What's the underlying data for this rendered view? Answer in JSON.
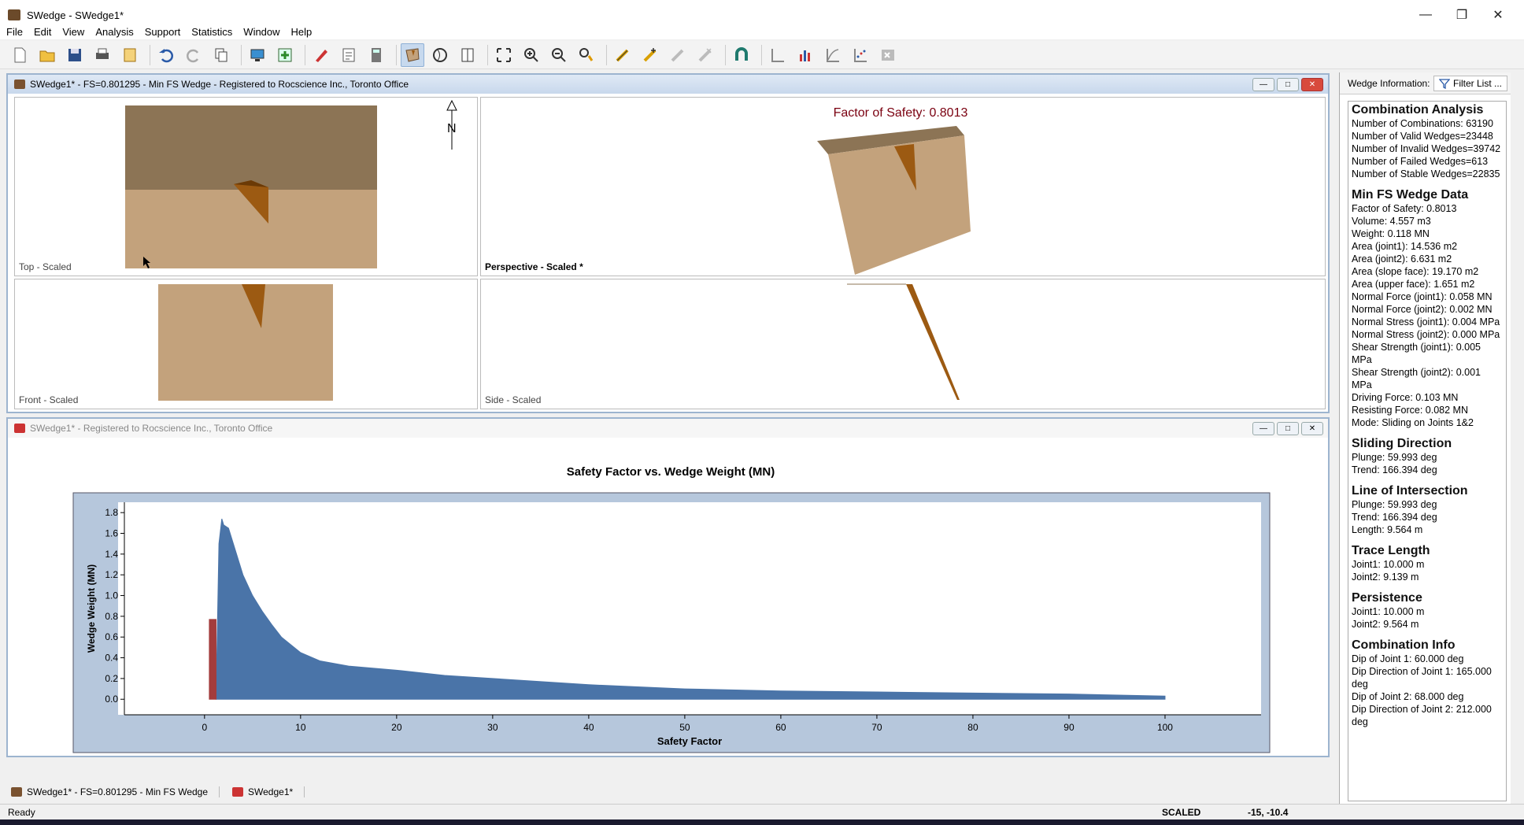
{
  "window": {
    "title": "SWedge - SWedge1*"
  },
  "menu": [
    "File",
    "Edit",
    "View",
    "Analysis",
    "Support",
    "Statistics",
    "Window",
    "Help"
  ],
  "view_window": {
    "title": "SWedge1* - FS=0.801295 - Min FS Wedge - Registered to Rocscience Inc., Toronto Office",
    "top_label": "Top - Scaled",
    "persp_label": "Perspective - Scaled *",
    "front_label": "Front - Scaled",
    "side_label": "Side - Scaled",
    "fs_title": "Factor of Safety: 0.8013",
    "north_label": "N"
  },
  "chart_window": {
    "title": "SWedge1* - Registered to Rocscience Inc., Toronto Office"
  },
  "chart_data": {
    "type": "area",
    "title": "Safety Factor vs. Wedge Weight (MN)",
    "xlabel": "Safety Factor",
    "ylabel": "Wedge Weight (MN)",
    "xlim": [
      -9,
      110
    ],
    "ylim": [
      -0.15,
      1.9
    ],
    "xticks": [
      0,
      10,
      20,
      30,
      40,
      50,
      60,
      70,
      80,
      90,
      100
    ],
    "yticks": [
      0.0,
      0.2,
      0.4,
      0.6,
      0.8,
      1.0,
      1.2,
      1.4,
      1.6,
      1.8
    ],
    "series": [
      {
        "color": "#4a74a8",
        "x": [
          1.2,
          1.5,
          1.8,
          2.0,
          2.5,
          3.0,
          3.5,
          4.0,
          5.0,
          6.0,
          7.0,
          8.0,
          10,
          12,
          15,
          20,
          25,
          30,
          40,
          50,
          60,
          70,
          80,
          90,
          100
        ],
        "y": [
          0.0,
          1.5,
          1.74,
          1.68,
          1.65,
          1.5,
          1.35,
          1.2,
          1.0,
          0.85,
          0.72,
          0.6,
          0.45,
          0.37,
          0.32,
          0.28,
          0.23,
          0.2,
          0.14,
          0.1,
          0.08,
          0.07,
          0.06,
          0.05,
          0.03
        ]
      },
      {
        "color": "#a33c3c",
        "x": [
          0.5,
          0.5,
          1.2,
          1.2
        ],
        "y": [
          0.0,
          0.77,
          0.77,
          0.0
        ]
      }
    ]
  },
  "info_panel": {
    "header_label": "Wedge Information:",
    "filter_label": "Filter List ...",
    "sections": [
      {
        "title": "Combination Analysis",
        "lines": [
          "Number of Combinations: 63190",
          "Number of Valid Wedges=23448",
          "Number of Invalid Wedges=39742",
          "Number of Failed Wedges=613",
          "Number of Stable Wedges=22835"
        ]
      },
      {
        "title": "Min FS Wedge Data",
        "lines": [
          "Factor of Safety: 0.8013",
          "Volume: 4.557 m3",
          "Weight: 0.118 MN",
          "Area (joint1): 14.536 m2",
          "Area (joint2): 6.631 m2",
          "Area (slope face): 19.170 m2",
          "Area (upper face): 1.651 m2",
          "Normal Force (joint1): 0.058 MN",
          "Normal Force (joint2): 0.002 MN",
          "Normal Stress (joint1): 0.004 MPa",
          "Normal Stress (joint2): 0.000 MPa",
          "Shear Strength (joint1): 0.005 MPa",
          "Shear Strength (joint2): 0.001 MPa",
          "Driving Force: 0.103 MN",
          "Resisting Force: 0.082 MN",
          "Mode: Sliding on Joints 1&2"
        ]
      },
      {
        "title": "Sliding Direction",
        "lines": [
          "Plunge: 59.993 deg",
          "Trend: 166.394 deg"
        ]
      },
      {
        "title": "Line of Intersection",
        "lines": [
          "Plunge: 59.993 deg",
          "Trend: 166.394 deg",
          "Length: 9.564 m"
        ]
      },
      {
        "title": "Trace Length",
        "lines": [
          "Joint1: 10.000 m",
          "Joint2: 9.139 m"
        ]
      },
      {
        "title": "Persistence",
        "lines": [
          "Joint1: 10.000 m",
          "Joint2: 9.564 m"
        ]
      },
      {
        "title": "Combination Info",
        "lines": [
          "Dip of Joint 1: 60.000 deg",
          "Dip Direction of Joint 1: 165.000 deg",
          "Dip of Joint 2: 68.000 deg",
          "Dip Direction of Joint 2: 212.000 deg"
        ]
      }
    ]
  },
  "tabs": [
    "SWedge1* - FS=0.801295 - Min FS Wedge",
    "SWedge1*"
  ],
  "status": {
    "left": "Ready",
    "mode": "SCALED",
    "coords": "-15, -10.4"
  },
  "colors": {
    "rock_dark": "#8c7455",
    "rock_light": "#c3a27c",
    "wedge": "#9c5a12",
    "fs_title": "#7a0010",
    "plot_frame": "#b6c7dc"
  }
}
